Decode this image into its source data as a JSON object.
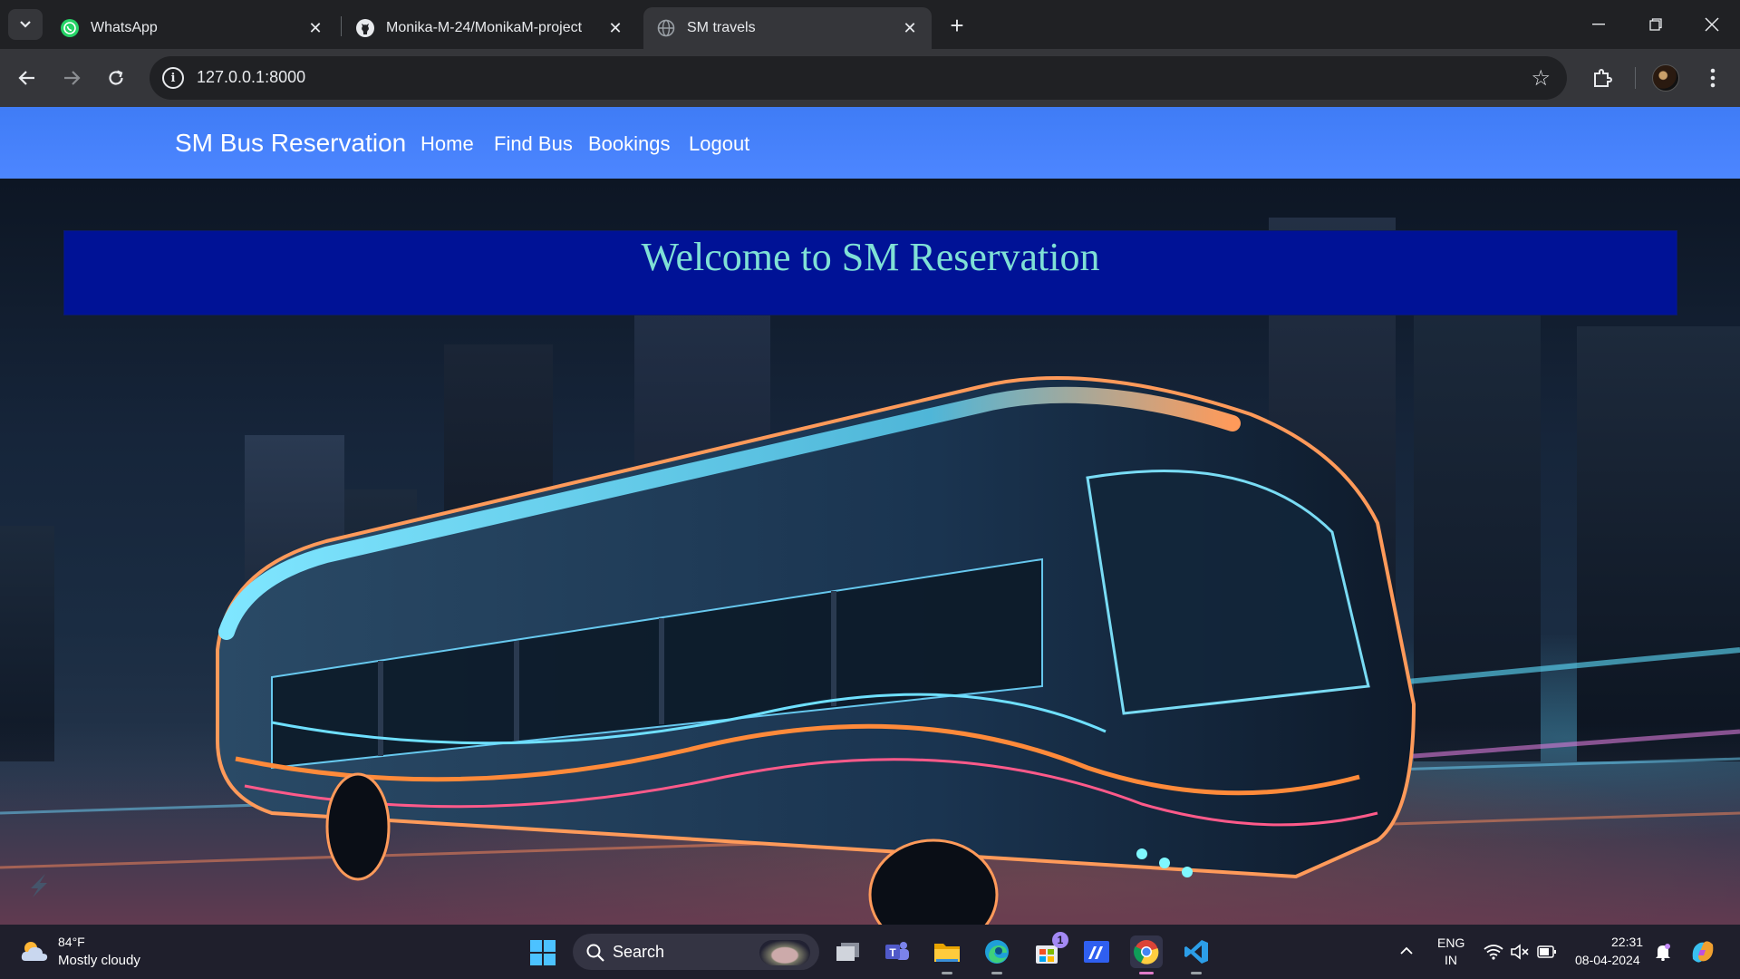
{
  "browser": {
    "tabs": [
      {
        "title": "WhatsApp",
        "icon": "whatsapp-icon"
      },
      {
        "title": "Monika-M-24/MonikaM-project",
        "icon": "github-icon"
      },
      {
        "title": "SM travels",
        "icon": "globe-icon",
        "active": true
      }
    ],
    "url": "127.0.0.1:8000"
  },
  "site": {
    "brand": "SM Bus Reservation",
    "nav": [
      "Home",
      "Find Bus",
      "Bookings",
      "Logout"
    ],
    "welcome": "Welcome to SM Reservation",
    "colors": {
      "navbar": "#4582fb",
      "banner": "#001296",
      "banner_text": "#7fe0d6"
    }
  },
  "taskbar": {
    "weather_temp": "84°F",
    "weather_desc": "Mostly cloudy",
    "search_label": "Search",
    "store_badge": "1",
    "lang_line1": "ENG",
    "lang_line2": "IN",
    "time": "22:31",
    "date": "08-04-2024"
  }
}
